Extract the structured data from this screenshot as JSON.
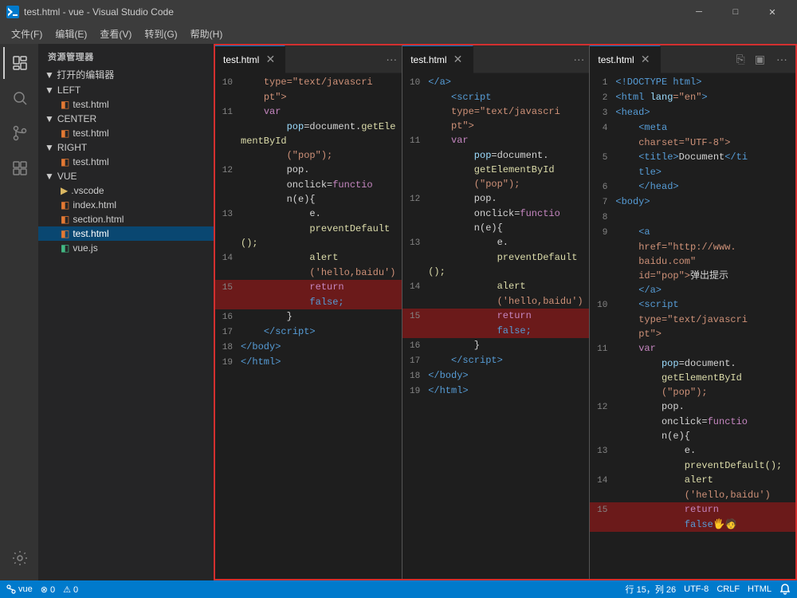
{
  "titlebar": {
    "title": "test.html - vue - Visual Studio Code",
    "icon": "VS",
    "btn_minimize": "─",
    "btn_restore": "□",
    "btn_close": "✕"
  },
  "menubar": {
    "items": [
      "文件(F)",
      "编辑(E)",
      "查看(V)",
      "转到(G)",
      "帮助(H)"
    ]
  },
  "sidebar": {
    "explorer_label": "资源管理器",
    "open_editors": "▼ 打开的编辑器",
    "groups": [
      {
        "label": "▼ LEFT",
        "items": [
          "test.html"
        ]
      },
      {
        "label": "▼ CENTER",
        "items": [
          "test.html"
        ]
      },
      {
        "label": "▼ RIGHT",
        "items": [
          "test.html"
        ]
      },
      {
        "label": "▼ VUE",
        "items": [
          ".vscode",
          "index.html",
          "section.html",
          "test.html",
          "vue.js"
        ]
      }
    ]
  },
  "editors": [
    {
      "tab_label": "test.html",
      "active": true,
      "lines": [
        {
          "num": "10",
          "tokens": [
            {
              "text": "    type=\"text/javascri",
              "cls": "hl-str"
            }
          ]
        },
        {
          "num": "",
          "tokens": [
            {
              "text": "    pt\">",
              "cls": "hl-str"
            }
          ]
        },
        {
          "num": "11",
          "tokens": [
            {
              "text": "    ",
              "cls": ""
            },
            {
              "text": "var",
              "cls": "hl-keyword"
            }
          ]
        },
        {
          "num": "",
          "tokens": [
            {
              "text": "        pop",
              "cls": "hl-var"
            },
            {
              "text": "=document.",
              "cls": ""
            },
            {
              "text": "getElementById",
              "cls": "hl-func"
            }
          ]
        },
        {
          "num": "",
          "tokens": [
            {
              "text": "        (\"pop\");",
              "cls": "hl-str"
            }
          ]
        },
        {
          "num": "12",
          "tokens": [
            {
              "text": "        pop.",
              "cls": ""
            }
          ]
        },
        {
          "num": "",
          "tokens": [
            {
              "text": "        onclick=",
              "cls": ""
            },
            {
              "text": "functio",
              "cls": "hl-keyword"
            }
          ]
        },
        {
          "num": "",
          "tokens": [
            {
              "text": "        n(e){",
              "cls": ""
            }
          ]
        },
        {
          "num": "13",
          "tokens": [
            {
              "text": "            e.",
              "cls": ""
            }
          ]
        },
        {
          "num": "",
          "tokens": [
            {
              "text": "            preventDefault();",
              "cls": "hl-func"
            }
          ]
        },
        {
          "num": "14",
          "tokens": [
            {
              "text": "            alert",
              "cls": "hl-func"
            }
          ]
        },
        {
          "num": "",
          "tokens": [
            {
              "text": "            ('hello,baidu')",
              "cls": "hl-str"
            }
          ]
        },
        {
          "num": "15",
          "tokens": [
            {
              "text": "            return",
              "cls": "hl-keyword"
            }
          ],
          "highlight": true
        },
        {
          "num": "",
          "tokens": [
            {
              "text": "            false;",
              "cls": "hl-bool"
            }
          ],
          "highlight": true
        },
        {
          "num": "16",
          "tokens": [
            {
              "text": "        }",
              "cls": ""
            }
          ]
        },
        {
          "num": "17",
          "tokens": [
            {
              "text": "    </",
              "cls": "hl-tag"
            },
            {
              "text": "script",
              "cls": "hl-tag"
            },
            {
              "text": ">",
              "cls": "hl-tag"
            }
          ]
        },
        {
          "num": "18",
          "tokens": [
            {
              "text": "</",
              "cls": "hl-tag"
            },
            {
              "text": "body",
              "cls": "hl-tag"
            },
            {
              "text": ">",
              "cls": "hl-tag"
            }
          ]
        },
        {
          "num": "19",
          "tokens": [
            {
              "text": "</",
              "cls": "hl-tag"
            },
            {
              "text": "html",
              "cls": "hl-tag"
            },
            {
              "text": ">",
              "cls": "hl-tag"
            }
          ]
        }
      ]
    },
    {
      "tab_label": "test.html",
      "active": true,
      "lines": [
        {
          "num": "10",
          "tokens": [
            {
              "text": "    </",
              "cls": "hl-tag"
            },
            {
              "text": "a",
              "cls": "hl-tag"
            },
            {
              "text": ">",
              "cls": "hl-tag"
            }
          ]
        },
        {
          "num": "",
          "tokens": [
            {
              "text": "    <",
              "cls": "hl-tag"
            },
            {
              "text": "script",
              "cls": "hl-tag"
            }
          ]
        },
        {
          "num": "",
          "tokens": [
            {
              "text": "    type=\"text/javascri",
              "cls": "hl-str"
            }
          ]
        },
        {
          "num": "",
          "tokens": [
            {
              "text": "    pt\">",
              "cls": "hl-str"
            }
          ]
        },
        {
          "num": "11",
          "tokens": [
            {
              "text": "    ",
              "cls": ""
            },
            {
              "text": "var",
              "cls": "hl-keyword"
            }
          ]
        },
        {
          "num": "",
          "tokens": [
            {
              "text": "        pop",
              "cls": "hl-var"
            },
            {
              "text": "=document.",
              "cls": ""
            }
          ]
        },
        {
          "num": "",
          "tokens": [
            {
              "text": "        getElementById",
              "cls": "hl-func"
            }
          ]
        },
        {
          "num": "",
          "tokens": [
            {
              "text": "        (\"pop\");",
              "cls": "hl-str"
            }
          ]
        },
        {
          "num": "12",
          "tokens": [
            {
              "text": "        pop.",
              "cls": ""
            }
          ]
        },
        {
          "num": "",
          "tokens": [
            {
              "text": "        onclick=",
              "cls": ""
            },
            {
              "text": "functio",
              "cls": "hl-keyword"
            }
          ]
        },
        {
          "num": "",
          "tokens": [
            {
              "text": "        n(e){",
              "cls": ""
            }
          ]
        },
        {
          "num": "13",
          "tokens": [
            {
              "text": "            e.",
              "cls": ""
            }
          ]
        },
        {
          "num": "",
          "tokens": [
            {
              "text": "            preventDefault();",
              "cls": "hl-func"
            }
          ]
        },
        {
          "num": "14",
          "tokens": [
            {
              "text": "            alert",
              "cls": "hl-func"
            }
          ]
        },
        {
          "num": "",
          "tokens": [
            {
              "text": "            ('hello,baidu')",
              "cls": "hl-str"
            }
          ]
        },
        {
          "num": "15",
          "tokens": [
            {
              "text": "            return",
              "cls": "hl-keyword"
            }
          ],
          "highlight": true
        },
        {
          "num": "",
          "tokens": [
            {
              "text": "            false;",
              "cls": "hl-bool"
            }
          ],
          "highlight": true
        },
        {
          "num": "16",
          "tokens": [
            {
              "text": "        }",
              "cls": ""
            }
          ]
        },
        {
          "num": "17",
          "tokens": [
            {
              "text": "    </",
              "cls": "hl-tag"
            },
            {
              "text": "script",
              "cls": "hl-tag"
            },
            {
              "text": ">",
              "cls": "hl-tag"
            }
          ]
        },
        {
          "num": "18",
          "tokens": [
            {
              "text": "</",
              "cls": "hl-tag"
            },
            {
              "text": "body",
              "cls": "hl-tag"
            },
            {
              "text": ">",
              "cls": "hl-tag"
            }
          ]
        },
        {
          "num": "19",
          "tokens": [
            {
              "text": "</",
              "cls": "hl-tag"
            },
            {
              "text": "html",
              "cls": "hl-tag"
            },
            {
              "text": ">",
              "cls": "hl-tag"
            }
          ]
        }
      ]
    },
    {
      "tab_label": "test.html",
      "active": true,
      "lines": [
        {
          "num": "1",
          "tokens": [
            {
              "text": "<!DOCTYPE html>",
              "cls": "hl-tag"
            }
          ]
        },
        {
          "num": "2",
          "tokens": [
            {
              "text": "<",
              "cls": "hl-tag"
            },
            {
              "text": "html ",
              "cls": "hl-tag"
            },
            {
              "text": "lang",
              "cls": "hl-attr"
            },
            {
              "text": "=\"en\">",
              "cls": "hl-str"
            }
          ]
        },
        {
          "num": "3",
          "tokens": [
            {
              "text": "<",
              "cls": "hl-tag"
            },
            {
              "text": "head",
              "cls": "hl-tag"
            },
            {
              "text": ">",
              "cls": "hl-tag"
            }
          ]
        },
        {
          "num": "4",
          "tokens": [
            {
              "text": "    <",
              "cls": "hl-tag"
            },
            {
              "text": "meta",
              "cls": "hl-tag"
            }
          ]
        },
        {
          "num": "",
          "tokens": [
            {
              "text": "    charset=\"UTF-8\">",
              "cls": "hl-str"
            }
          ]
        },
        {
          "num": "5",
          "tokens": [
            {
              "text": "    <",
              "cls": "hl-tag"
            },
            {
              "text": "title",
              "cls": "hl-tag"
            },
            {
              "text": ">Document</",
              "cls": ""
            },
            {
              "text": "ti",
              "cls": "hl-tag"
            }
          ]
        },
        {
          "num": "",
          "tokens": [
            {
              "text": "    tle>",
              "cls": "hl-tag"
            }
          ]
        },
        {
          "num": "6",
          "tokens": [
            {
              "text": "    </",
              "cls": "hl-tag"
            },
            {
              "text": "head",
              "cls": "hl-tag"
            },
            {
              "text": ">",
              "cls": "hl-tag"
            }
          ]
        },
        {
          "num": "7",
          "tokens": [
            {
              "text": "<",
              "cls": "hl-tag"
            },
            {
              "text": "body",
              "cls": "hl-tag"
            },
            {
              "text": ">",
              "cls": "hl-tag"
            }
          ]
        },
        {
          "num": "8",
          "tokens": []
        },
        {
          "num": "9",
          "tokens": [
            {
              "text": "    <",
              "cls": "hl-tag"
            },
            {
              "text": "a",
              "cls": "hl-tag"
            }
          ]
        },
        {
          "num": "",
          "tokens": [
            {
              "text": "    href=\"http://www.",
              "cls": "hl-str"
            }
          ]
        },
        {
          "num": "",
          "tokens": [
            {
              "text": "    baidu.com\"",
              "cls": "hl-str"
            }
          ]
        },
        {
          "num": "",
          "tokens": [
            {
              "text": "    id=\"pop\">弹出提示",
              "cls": "hl-str"
            }
          ]
        },
        {
          "num": "",
          "tokens": [
            {
              "text": "    </",
              "cls": "hl-tag"
            },
            {
              "text": "a",
              "cls": "hl-tag"
            },
            {
              "text": ">",
              "cls": "hl-tag"
            }
          ]
        },
        {
          "num": "10",
          "tokens": [
            {
              "text": "    <",
              "cls": "hl-tag"
            },
            {
              "text": "script",
              "cls": "hl-tag"
            }
          ]
        },
        {
          "num": "",
          "tokens": [
            {
              "text": "    type=\"text/javascri",
              "cls": "hl-str"
            }
          ]
        },
        {
          "num": "",
          "tokens": [
            {
              "text": "    pt\">",
              "cls": "hl-str"
            }
          ]
        },
        {
          "num": "11",
          "tokens": [
            {
              "text": "    ",
              "cls": ""
            },
            {
              "text": "var",
              "cls": "hl-keyword"
            }
          ]
        },
        {
          "num": "",
          "tokens": [
            {
              "text": "        pop",
              "cls": "hl-var"
            },
            {
              "text": "=document.",
              "cls": ""
            }
          ]
        },
        {
          "num": "",
          "tokens": [
            {
              "text": "        getElementById",
              "cls": "hl-func"
            }
          ]
        },
        {
          "num": "",
          "tokens": [
            {
              "text": "        (\"pop\");",
              "cls": "hl-str"
            }
          ]
        },
        {
          "num": "12",
          "tokens": [
            {
              "text": "        pop.",
              "cls": ""
            }
          ]
        },
        {
          "num": "",
          "tokens": [
            {
              "text": "        onclick=",
              "cls": ""
            },
            {
              "text": "functio",
              "cls": "hl-keyword"
            }
          ]
        },
        {
          "num": "",
          "tokens": [
            {
              "text": "        n(e){",
              "cls": ""
            }
          ]
        },
        {
          "num": "13",
          "tokens": [
            {
              "text": "            e.",
              "cls": ""
            }
          ]
        },
        {
          "num": "",
          "tokens": [
            {
              "text": "            preventDefault();",
              "cls": "hl-func"
            }
          ]
        },
        {
          "num": "14",
          "tokens": [
            {
              "text": "            alert",
              "cls": "hl-func"
            }
          ]
        },
        {
          "num": "",
          "tokens": [
            {
              "text": "            ('hello,baidu')",
              "cls": "hl-str"
            }
          ]
        },
        {
          "num": "15",
          "tokens": [
            {
              "text": "            return",
              "cls": "hl-keyword"
            }
          ],
          "highlight": true
        },
        {
          "num": "",
          "tokens": [
            {
              "text": "            false",
              "cls": "hl-bool"
            }
          ],
          "highlight": true
        }
      ]
    }
  ],
  "statusbar": {
    "errors": "⊗ 0",
    "warnings": "⚠ 0",
    "position": "行 15，列 26",
    "encoding": "UTF-8",
    "eol": "CRLF",
    "language": "HTML",
    "branch": "vue"
  }
}
